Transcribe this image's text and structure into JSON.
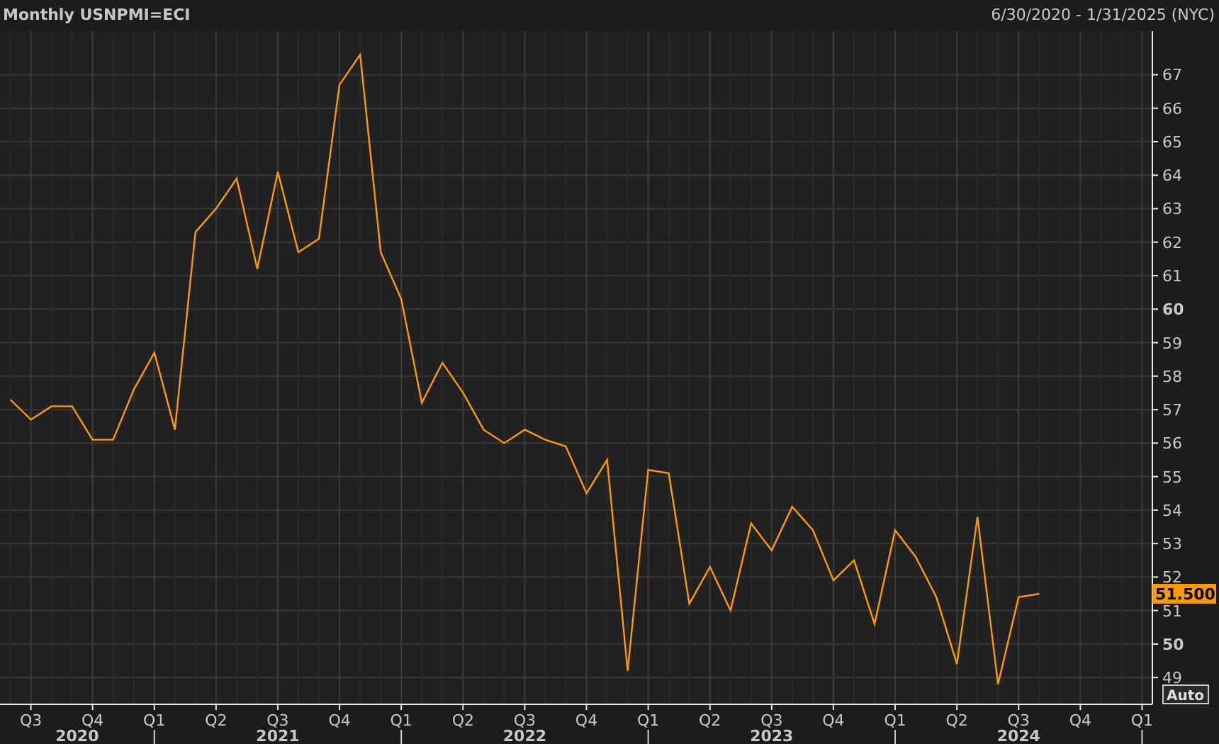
{
  "header": {
    "title": "Monthly USNPMI=ECI",
    "date_range": "6/30/2020 - 1/31/2025 (NYC)"
  },
  "chart": {
    "chart_data": {
      "type": "line",
      "categories": [
        null,
        "Q3",
        null,
        null,
        "Q4",
        null,
        null,
        "Q1",
        null,
        null,
        "Q2",
        null,
        null,
        "Q3",
        null,
        null,
        "Q4",
        null,
        null,
        "Q1",
        null,
        null,
        "Q2",
        null,
        null,
        "Q3",
        null,
        null,
        "Q4",
        null,
        null,
        "Q1",
        null,
        null,
        "Q2",
        null,
        null,
        "Q3",
        null,
        null,
        "Q4",
        null,
        null,
        "Q1",
        null,
        null,
        "Q2",
        null,
        null,
        "Q3",
        null,
        null,
        "Q4",
        null,
        null,
        "Q1"
      ],
      "series": [
        {
          "color": "#ff9900",
          "values": [
            57.3,
            56.7,
            57.1,
            57.1,
            56.1,
            56.1,
            57.6,
            58.7,
            56.4,
            62.3,
            63.0,
            63.9,
            61.2,
            64.1,
            61.7,
            62.1,
            66.7,
            67.6,
            61.7,
            60.3,
            57.2,
            58.4,
            57.5,
            56.4,
            56.0,
            56.4,
            56.1,
            55.9,
            54.5,
            55.5,
            49.2,
            55.2,
            55.1,
            51.2,
            52.3,
            51.0,
            53.6,
            52.8,
            54.1,
            53.4,
            51.9,
            52.5,
            50.6,
            53.4,
            52.6,
            51.4,
            49.4,
            53.8,
            48.8,
            51.4,
            51.5,
            null,
            null,
            null,
            null,
            null
          ]
        }
      ],
      "ylim": [
        48.2,
        68.3
      ],
      "grid": true,
      "yticks": [
        49,
        50,
        51,
        52,
        53,
        54,
        55,
        56,
        57,
        58,
        59,
        60,
        61,
        62,
        63,
        64,
        65,
        66,
        67
      ]
    },
    "years": [
      "2020",
      "2021",
      "2022",
      "2023",
      "2024"
    ],
    "last_value": "51.500",
    "scale_button": "Auto"
  }
}
